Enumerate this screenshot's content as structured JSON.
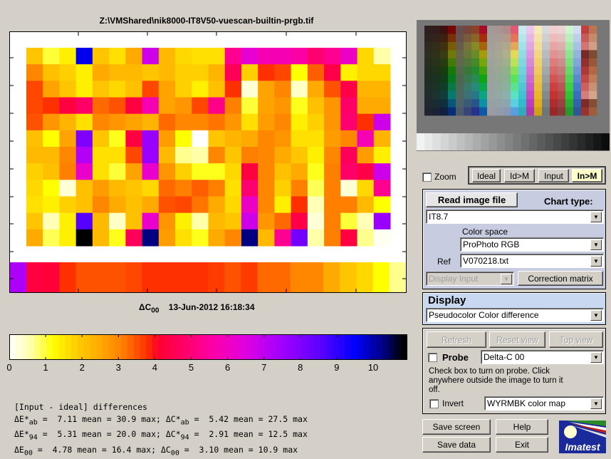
{
  "window": {
    "title": "Z:\\VMShared\\nik8000-IT8V50-vuescan-builtin-prgb.tif"
  },
  "plot": {
    "metric_symbol": "ΔC",
    "metric_sub": "00",
    "timestamp": "13-Jun-2012 16:18:34"
  },
  "chart_data": {
    "type": "heatmap",
    "colormap": "WYRMBK",
    "value_range": [
      0,
      10.9
    ],
    "colorbar_ticks": [
      "0",
      "1",
      "2",
      "3",
      "4",
      "5",
      "6",
      "7",
      "8",
      "9",
      "10"
    ],
    "patch_grid": [
      [
        2.0,
        1.0,
        1.4,
        9.6,
        2.0,
        1.6,
        2.5,
        6.8,
        2.2,
        1.7,
        1.6,
        1.6,
        5.3,
        6.3,
        5.8,
        5.8,
        5.6,
        4.9,
        5.3,
        6.1,
        1.7,
        0.6
      ],
      [
        3.0,
        2.1,
        1.8,
        1.4,
        2.5,
        2.2,
        2.2,
        2.0,
        2.2,
        1.8,
        1.8,
        2.3,
        4.6,
        1.8,
        3.8,
        3.6,
        1.2,
        3.4,
        4.4,
        1.4,
        1.7,
        1.7
      ],
      [
        3.6,
        2.6,
        2.0,
        1.4,
        2.0,
        1.7,
        2.1,
        3.6,
        2.6,
        1.8,
        1.4,
        2.1,
        3.8,
        0.3,
        2.6,
        3.0,
        0.4,
        2.5,
        3.5,
        4.4,
        2.3,
        2.3
      ],
      [
        3.6,
        3.8,
        4.3,
        4.8,
        3.3,
        3.5,
        4.3,
        5.8,
        2.6,
        2.8,
        3.6,
        5.2,
        3.1,
        1.0,
        2.6,
        2.8,
        1.1,
        2.1,
        2.8,
        4.8,
        2.5,
        2.5
      ],
      [
        3.5,
        2.8,
        2.3,
        1.6,
        3.0,
        2.8,
        2.6,
        2.3,
        3.3,
        3.0,
        3.0,
        3.2,
        2.8,
        1.6,
        2.7,
        3.0,
        1.4,
        1.8,
        2.8,
        4.9,
        3.8,
        6.8
      ],
      [
        2.1,
        1.2,
        2.6,
        8.0,
        2.0,
        1.1,
        4.3,
        7.6,
        2.7,
        1.2,
        0.0,
        2.0,
        2.3,
        2.5,
        3.0,
        2.8,
        1.6,
        1.6,
        2.7,
        3.0,
        5.8,
        2.3
      ],
      [
        2.2,
        2.2,
        3.0,
        7.2,
        1.6,
        1.6,
        3.6,
        7.6,
        2.2,
        0.7,
        0.6,
        3.0,
        2.0,
        3.1,
        3.0,
        2.5,
        2.0,
        1.4,
        3.0,
        4.6,
        2.7,
        1.4
      ],
      [
        1.8,
        2.1,
        3.1,
        6.2,
        1.6,
        1.0,
        2.6,
        6.2,
        2.8,
        1.8,
        1.1,
        1.1,
        1.7,
        4.3,
        3.0,
        2.1,
        2.5,
        1.1,
        3.1,
        4.8,
        4.4,
        6.8
      ],
      [
        1.7,
        1.2,
        0.3,
        2.1,
        2.7,
        2.2,
        2.0,
        1.7,
        3.3,
        3.1,
        3.4,
        3.1,
        1.6,
        4.9,
        3.0,
        1.8,
        3.1,
        0.9,
        3.1,
        0.3,
        1.7,
        5.3
      ],
      [
        1.6,
        1.4,
        1.8,
        2.1,
        3.0,
        2.5,
        2.1,
        2.5,
        3.5,
        3.6,
        3.2,
        2.5,
        1.7,
        6.1,
        3.0,
        1.4,
        3.8,
        0.5,
        3.1,
        3.1,
        2.2,
        1.2
      ],
      [
        2.0,
        0.5,
        1.4,
        8.6,
        2.2,
        0.4,
        2.1,
        6.2,
        2.8,
        1.4,
        0.6,
        2.2,
        2.0,
        6.8,
        2.8,
        3.3,
        4.4,
        0.3,
        3.1,
        1.0,
        0.5,
        7.6
      ],
      [
        2.5,
        0.9,
        1.4,
        10.9,
        2.2,
        1.1,
        4.6,
        10.3,
        2.7,
        1.6,
        1.1,
        2.5,
        3.0,
        10.3,
        2.2,
        5.3,
        8.2,
        0.6,
        3.1,
        4.3,
        0.7,
        0.1
      ]
    ],
    "gray_row": [
      7.3,
      4.3,
      4.2,
      3.8,
      3.5,
      3.5,
      3.5,
      3.6,
      3.8,
      3.8,
      3.8,
      3.8,
      3.7,
      3.5,
      3.7,
      3.3,
      3.3,
      3.0,
      3.0,
      2.5,
      2.0,
      1.7,
      1.2,
      0.7
    ]
  },
  "stats": {
    "heading": "[Input - ideal] differences",
    "rows": [
      {
        "a_sym": "ΔE*",
        "a_sub": "ab",
        "a_mean": "7.11",
        "a_max": "30.9",
        "b_sym": "ΔC*",
        "b_sub": "ab",
        "b_mean": "5.42",
        "b_max": "27.5"
      },
      {
        "a_sym": "ΔE*",
        "a_sub": "94",
        "a_mean": "5.31",
        "a_max": "20.0",
        "b_sym": "ΔC*",
        "b_sub": "94",
        "b_mean": "2.91",
        "b_max": "12.5"
      },
      {
        "a_sym": "ΔE",
        "a_sub": "00",
        "a_mean": "4.78",
        "a_max": "16.4",
        "b_sym": "ΔC",
        "b_sub": "00",
        "b_mean": "3.10",
        "b_max": "10.9"
      }
    ],
    "mean_word": "mean",
    "max_word": "max"
  },
  "controls": {
    "zoom_label": "Zoom",
    "zoom_checked": false,
    "view_buttons": [
      "Ideal",
      "Id>M",
      "Input",
      "In>M"
    ],
    "active_view": "In>M",
    "read_image": "Read image file",
    "chart_type_label": "Chart type:",
    "chart_type": "IT8.7",
    "color_space_label": "Color space",
    "color_space": "ProPhoto RGB",
    "ref_label": "Ref",
    "ref": "V070218.txt",
    "display_input": "Display Input",
    "correction_matrix": "Correction matrix",
    "display_heading": "Display",
    "display_mode": "Pseudocolor Color difference",
    "refresh": "Refresh",
    "reset_view": "Reset view",
    "top_view": "Top view",
    "probe_label": "Probe",
    "probe_checked": false,
    "probe_value": "Delta-C 00",
    "probe_help": "Check box to turn on probe. Click anywhere outside the image to turn it off.",
    "invert_label": "Invert",
    "invert_checked": false,
    "colormap": "WYRMBK color map",
    "save_screen": "Save screen",
    "help": "Help",
    "save_data": "Save data",
    "exit": "Exit",
    "logo_text": "Imatest"
  },
  "colors": {
    "accent_active": "#ffffc8",
    "panel_chart": "#c8cce0",
    "panel_display": "#c8d8f0"
  }
}
